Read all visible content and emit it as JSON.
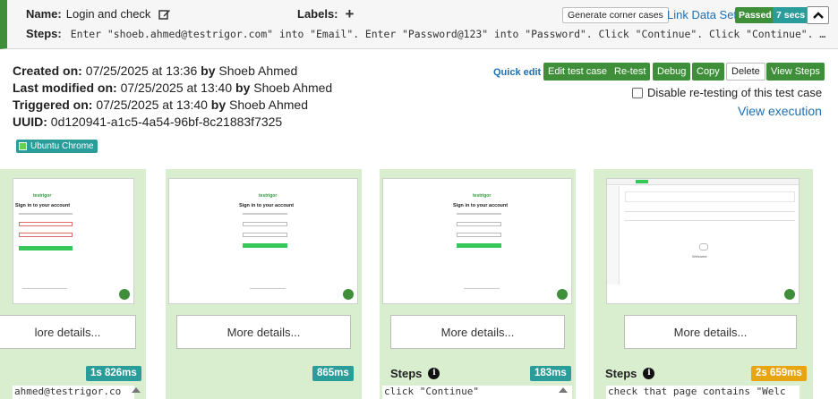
{
  "header": {
    "name_label": "Name:",
    "name_value": "Login and check",
    "labels_label": "Labels:",
    "steps_label": "Steps:",
    "steps_value": "Enter \"shoeb.ahmed@testrigor.com\" into \"Email\". Enter \"Password@123\" into \"Password\". Click \"Continue\". Click \"Continue\". …",
    "generate_corner_cases": "Generate corner cases",
    "link_data_set": "Link Data Set",
    "status": "Passed",
    "duration": "7 secs"
  },
  "meta": {
    "created_label": "Created on:",
    "created_value": "07/25/2025 at 13:36",
    "created_by_label": "by",
    "created_by": "Shoeb Ahmed",
    "modified_label": "Last modified on:",
    "modified_value": "07/25/2025 at 13:40",
    "modified_by_label": "by",
    "modified_by": "Shoeb Ahmed",
    "triggered_label": "Triggered on:",
    "triggered_value": "07/25/2025 at 13:40",
    "triggered_by_label": "by",
    "triggered_by": "Shoeb Ahmed",
    "uuid_label": "UUID:",
    "uuid_value": "0d120941-a1c5-4a54-96bf-8c21883f7325",
    "platform_tag": "Ubuntu Chrome"
  },
  "actions": {
    "quick_edit": "Quick edit",
    "edit_test_case": "Edit test case",
    "retest": "Re-test",
    "debug": "Debug",
    "copy": "Copy",
    "delete": "Delete",
    "view_steps": "View Steps",
    "disable_retesting": "Disable re-testing of this test case",
    "view_execution": "View execution"
  },
  "cards": [
    {
      "more": "lore details...",
      "duration": "1s 826ms",
      "steps_title": "",
      "code": "ahmed@testrigor.co"
    },
    {
      "more": "More details...",
      "duration": "865ms",
      "steps_title": "",
      "code": ""
    },
    {
      "more": "More details...",
      "duration": "183ms",
      "steps_title": "Steps",
      "code": "click \"Continue\""
    },
    {
      "more": "More details...",
      "duration": "2s 659ms",
      "steps_title": "Steps",
      "code": "check that page contains \"Welc"
    }
  ],
  "mini": {
    "logo": "testrigor",
    "signin_title": "Sign in to your account",
    "welcome_text": "Welcome"
  },
  "colors": {
    "green": "#3f8f3a",
    "teal": "#2a9c99",
    "orange": "#e8a512",
    "card_bg": "#d9edcf",
    "link": "#1f6fb2"
  }
}
